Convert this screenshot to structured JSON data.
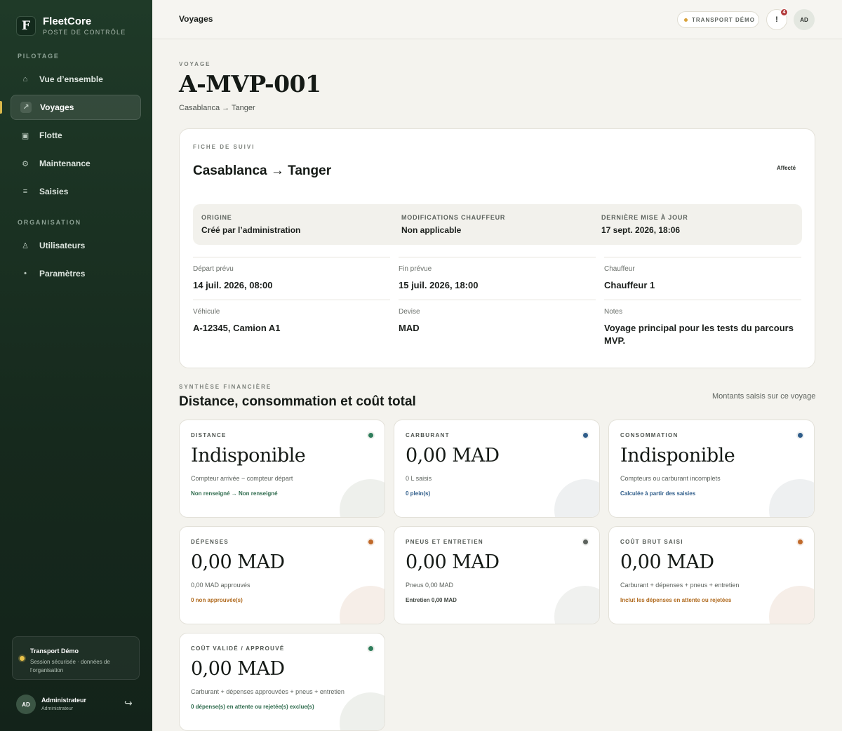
{
  "brand": {
    "logo_letter": "F",
    "name": "FleetCore",
    "subtitle": "POSTE DE CONTRÔLE"
  },
  "sidebar": {
    "section_pilotage": "PILOTAGE",
    "section_organisation": "ORGANISATION",
    "items": [
      {
        "label": "Vue d’ensemble",
        "icon": "home-icon",
        "glyph": "⌂"
      },
      {
        "label": "Voyages",
        "icon": "route-icon",
        "glyph": "↗",
        "active": true
      },
      {
        "label": "Flotte",
        "icon": "truck-icon",
        "glyph": "▣"
      },
      {
        "label": "Maintenance",
        "icon": "wrench-icon",
        "glyph": "⚙"
      },
      {
        "label": "Saisies",
        "icon": "list-icon",
        "glyph": "≡"
      },
      {
        "label": "Utilisateurs",
        "icon": "users-icon",
        "glyph": "♙"
      },
      {
        "label": "Paramètres",
        "icon": "settings-icon",
        "glyph": "•"
      }
    ],
    "org_card": {
      "name": "Transport Démo",
      "description": "Session sécurisée · données de l’organisation"
    },
    "user": {
      "initials": "AD",
      "name": "Administrateur",
      "role": "Administrateur"
    }
  },
  "topbar": {
    "title": "Voyages",
    "org_pill": "TRANSPORT DÉMO",
    "notifications_glyph": "!",
    "notifications_count": "4",
    "avatar_initials": "AD"
  },
  "page": {
    "kicker": "VOYAGE",
    "title": "A-MVP-001",
    "subtitle": "Casablanca → Tanger"
  },
  "tracking": {
    "kicker": "FICHE DE SUIVI",
    "route": "Casablanca → Tanger",
    "status": "Affecté",
    "meta": [
      {
        "label": "ORIGINE",
        "value": "Créé par l’administration"
      },
      {
        "label": "MODIFICATIONS CHAUFFEUR",
        "value": "Non applicable"
      },
      {
        "label": "DERNIÈRE MISE À JOUR",
        "value": "17 sept. 2026, 18:06"
      }
    ],
    "fields": [
      {
        "label": "Départ prévu",
        "value": "14 juil. 2026, 08:00"
      },
      {
        "label": "Fin prévue",
        "value": "15 juil. 2026, 18:00"
      },
      {
        "label": "Chauffeur",
        "value": "Chauffeur 1"
      },
      {
        "label": "Véhicule",
        "value": "A-12345, Camion A1"
      },
      {
        "label": "Devise",
        "value": "MAD"
      },
      {
        "label": "Notes",
        "value": "Voyage principal pour les tests du parcours MVP."
      }
    ]
  },
  "finance": {
    "kicker": "SYNTHÈSE FINANCIÈRE",
    "title": "Distance, consommation et coût total",
    "note": "Montants saisis sur ce voyage",
    "cards": [
      {
        "label": "DISTANCE",
        "value": "Indisponible",
        "desc": "Compteur arrivée − compteur départ",
        "foot": "Non renseigné → Non renseigné",
        "dot": "#2e7d5b",
        "foot_color": "#2e6b4d",
        "circle": "#eef0ec"
      },
      {
        "label": "CARBURANT",
        "value": "0,00 MAD",
        "desc": "0 L saisis",
        "foot": "0 plein(s)",
        "dot": "#2f5d8a",
        "foot_color": "#2f5d8a",
        "circle": "#eef0f1"
      },
      {
        "label": "CONSOMMATION",
        "value": "Indisponible",
        "desc": "Compteurs ou carburant incomplets",
        "foot": "Calculée à partir des saisies",
        "dot": "#2f5d8a",
        "foot_color": "#2f5d8a",
        "circle": "#eef0f1"
      },
      {
        "label": "DÉPENSES",
        "value": "0,00 MAD",
        "desc": "0,00 MAD approuvés",
        "foot": "0 non approuvée(s)",
        "dot": "#c0692a",
        "foot_color": "#b06a1e",
        "circle": "#f6eee8"
      },
      {
        "label": "PNEUS ET ENTRETIEN",
        "value": "0,00 MAD",
        "desc": "Pneus 0,00 MAD",
        "foot": "Entretien 0,00 MAD",
        "dot": "#5c625d",
        "foot_color": "#3f4540",
        "circle": "#f0f1ef"
      },
      {
        "label": "COÛT BRUT SAISI",
        "value": "0,00 MAD",
        "desc": "Carburant + dépenses + pneus + entretien",
        "foot": "Inclut les dépenses en attente ou rejetées",
        "dot": "#c0692a",
        "foot_color": "#b06a1e",
        "circle": "#f6eee8"
      },
      {
        "label": "COÛT VALIDÉ / APPROUVÉ",
        "value": "0,00 MAD",
        "desc": "Carburant + dépenses approuvées + pneus + entretien",
        "foot": "0 dépense(s) en attente ou rejetée(s) exclue(s)",
        "dot": "#2e7d5b",
        "foot_color": "#2e6b4d",
        "circle": "#eef0ec"
      }
    ]
  }
}
